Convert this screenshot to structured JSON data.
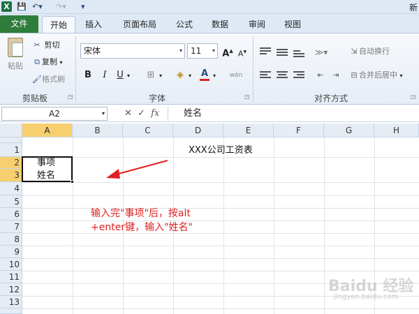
{
  "title_bar": {
    "app_icon": "excel-icon",
    "title": "新"
  },
  "tabs": [
    {
      "label": "文件"
    },
    {
      "label": "开始"
    },
    {
      "label": "插入"
    },
    {
      "label": "页面布局"
    },
    {
      "label": "公式"
    },
    {
      "label": "数据"
    },
    {
      "label": "审阅"
    },
    {
      "label": "视图"
    }
  ],
  "ribbon": {
    "clipboard": {
      "paste": "粘贴",
      "cut": "剪切",
      "copy": "复制",
      "format_painter": "格式刷",
      "label": "剪贴板"
    },
    "font": {
      "name": "宋体",
      "size": "11",
      "bold": "B",
      "italic": "I",
      "underline": "U",
      "font_color": "A",
      "phonetic": "wén",
      "label": "字体",
      "font_color_hex": "#e02020"
    },
    "alignment": {
      "wrap": "自动换行",
      "merge": "合并后居中",
      "label": "对齐方式"
    }
  },
  "formula_bar": {
    "name_box": "A2",
    "formula": "姓名"
  },
  "columns": [
    "A",
    "B",
    "C",
    "D",
    "E",
    "F",
    "G",
    "H"
  ],
  "rows": [
    "1",
    "2",
    "3",
    "4",
    "5",
    "6",
    "7",
    "8",
    "9",
    "10",
    "11",
    "12",
    "13"
  ],
  "cells": {
    "D1": "XXX公司工资表",
    "A2_line1": "事项",
    "A2_line2": "姓名"
  },
  "annotation": {
    "line1": "输入完\"事项\"后，按alt",
    "line2": "+enter键，输入\"姓名\"",
    "color": "#e02020"
  },
  "watermark": {
    "text": "Baidu 经验",
    "sub": "jingyan.baidu.com"
  }
}
